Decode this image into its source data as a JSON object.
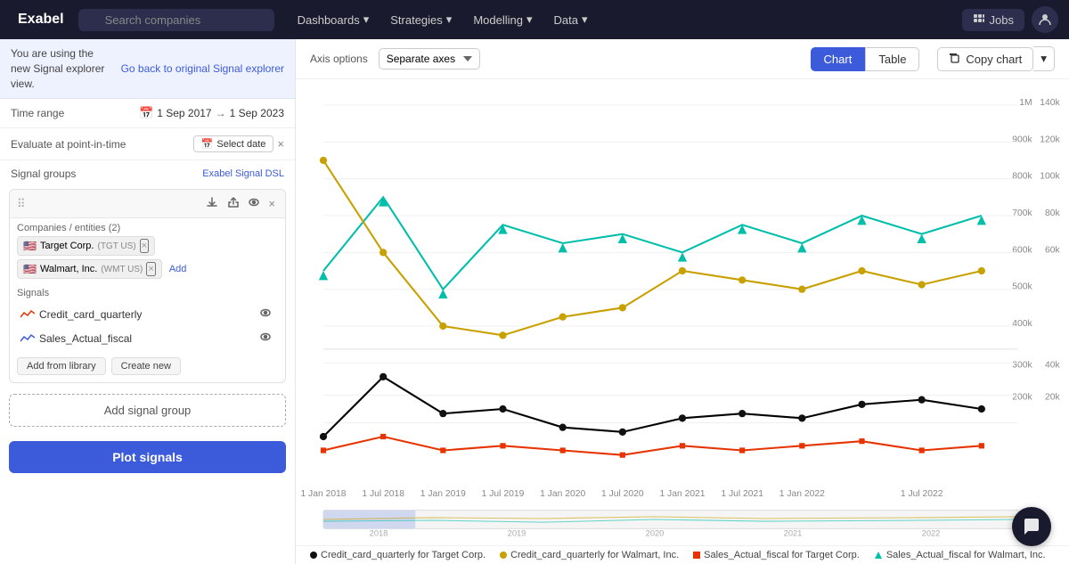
{
  "app": {
    "logo": "Exabel"
  },
  "topnav": {
    "search_placeholder": "Search companies",
    "menu_items": [
      "Dashboards",
      "Strategies",
      "Modelling",
      "Data"
    ],
    "jobs_label": "Jobs"
  },
  "left_panel": {
    "banner": {
      "text": "You are using the new Signal explorer view.",
      "link_label": "Go back to original Signal explorer"
    },
    "time_range": {
      "label": "Time range",
      "value": "1 Sep 2017",
      "arrow": "→",
      "value2": "1 Sep 2023"
    },
    "evaluate": {
      "label": "Evaluate at point-in-time",
      "btn_label": "Select date",
      "clear": "×"
    },
    "signal_groups": {
      "label": "Signal groups",
      "link": "Exabel Signal DSL"
    },
    "group_card": {
      "companies_label": "Companies / entities (2)",
      "companies": [
        {
          "flag": "🇺🇸",
          "name": "Target Corp.",
          "ticker": "TGT US"
        },
        {
          "flag": "🇺🇸",
          "name": "Walmart, Inc.",
          "ticker": "WMT US"
        }
      ],
      "add_label": "Add",
      "signals_label": "Signals",
      "signals": [
        {
          "name": "Credit_card_quarterly",
          "type": "line"
        },
        {
          "name": "Sales_Actual_fiscal",
          "type": "line"
        }
      ],
      "add_from_library": "Add from library",
      "create_new": "Create new"
    },
    "add_signal_group": "Add signal group",
    "plot_signals": "Plot signals"
  },
  "chart_toolbar": {
    "axis_options_label": "Axis options",
    "axis_select_value": "Separate axes",
    "chart_btn": "Chart",
    "table_btn": "Table",
    "copy_chart_btn": "Copy chart"
  },
  "chart": {
    "colors": {
      "tgt_credit": "#000000",
      "wmt_credit": "#c8a000",
      "tgt_sales": "#e63300",
      "wmt_sales": "#00bfaa"
    },
    "legend": [
      {
        "label": "Credit_card_quarterly for Target Corp.",
        "color": "#000000",
        "shape": "circle"
      },
      {
        "label": "Credit_card_quarterly for Walmart, Inc.",
        "color": "#c8a000",
        "shape": "circle"
      },
      {
        "label": "Sales_Actual_fiscal for Target Corp.",
        "color": "#e63300",
        "shape": "square"
      },
      {
        "label": "Sales_Actual_fiscal for Walmart, Inc.",
        "color": "#00bfaa",
        "shape": "triangle"
      }
    ],
    "x_axis_labels": [
      "1 Jan 2018",
      "1 Jul 2018",
      "1 Jan 2019",
      "1 Jul 2019",
      "1 Jan 2020",
      "1 Jul 2020",
      "1 Jan 2021",
      "1 Jul 2021",
      "1 Jan 2022",
      "1 Jul 2022"
    ],
    "y_axis_top": [
      "1M",
      "140k",
      "900k",
      "120k",
      "800k",
      "100k",
      "700k",
      "600k",
      "80k",
      "500k",
      "60k",
      "400k"
    ],
    "y_axis_bottom": [
      "40k",
      "300k",
      "20k",
      "200k"
    ]
  }
}
